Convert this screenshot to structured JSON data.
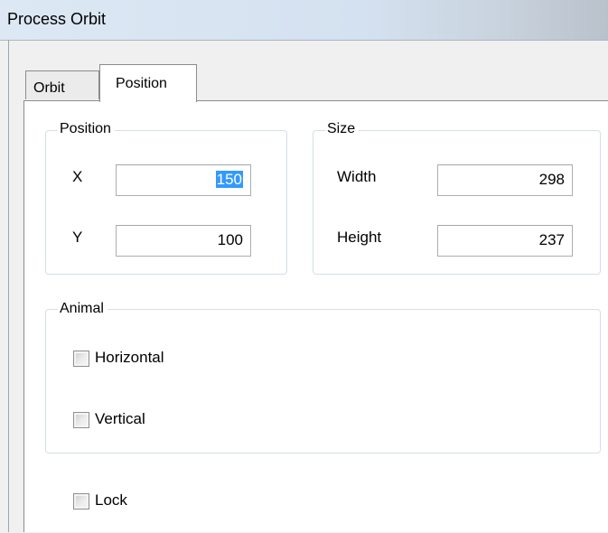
{
  "window": {
    "title": "Process Orbit"
  },
  "tabs": [
    {
      "label": "Orbit",
      "selected": false
    },
    {
      "label": "Position",
      "selected": true
    }
  ],
  "position_group": {
    "legend": "Position",
    "x_label": "X",
    "x_value": "150",
    "y_label": "Y",
    "y_value": "100"
  },
  "size_group": {
    "legend": "Size",
    "width_label": "Width",
    "width_value": "298",
    "height_label": "Height",
    "height_value": "237"
  },
  "animal_group": {
    "legend": "Animal",
    "horizontal": {
      "label": "Horizontal",
      "checked": false
    },
    "vertical": {
      "label": "Vertical",
      "checked": false
    }
  },
  "lock": {
    "label": "Lock",
    "checked": false
  }
}
